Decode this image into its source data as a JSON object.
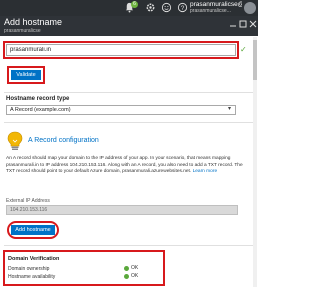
{
  "topbar": {
    "notification_count": "6",
    "user_email": "prasanmuralicse@...",
    "user_directory": "prasanmuralicse..."
  },
  "blade": {
    "title": "Add hostname",
    "subtitle": "prasanmuralicse"
  },
  "hostname": {
    "value": "prasanmurali.in"
  },
  "validate_label": "Validate",
  "record_type": {
    "label": "Hostname record type",
    "selected": "A Record (example.com)"
  },
  "config": {
    "title": "A Record configuration",
    "description": "An A record should map your domain to the IP address of your app. In your scenario, that means mapping prasanmurali.in to IP address 104.210.153.116. Along with an A record, you also need to add a TXT record. The TXT record should point to your default Azure domain, prasanmurali.azurewebsites.net.",
    "learn_more": "Learn more"
  },
  "external_ip": {
    "label": "External IP Address",
    "value": "104.210.153.116"
  },
  "add_hostname_label": "Add hostname",
  "domain_verification": {
    "title": "Domain Verification",
    "rows": [
      {
        "label": "Domain ownership",
        "status": "OK"
      },
      {
        "label": "Hostname availability",
        "status": "OK"
      }
    ]
  },
  "colors": {
    "accent": "#0072c6",
    "highlight": "#d7191c",
    "ok": "#5aa83b",
    "header": "#2f3338"
  }
}
